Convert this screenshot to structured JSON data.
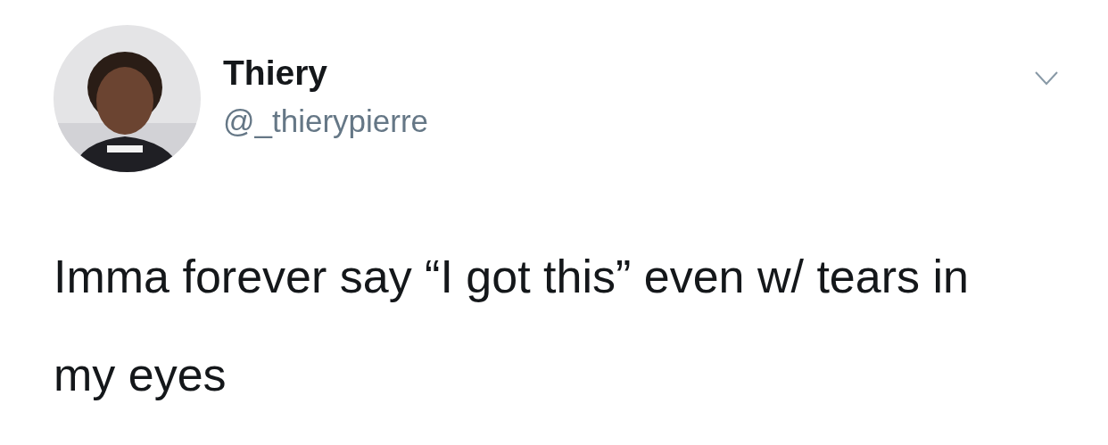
{
  "tweet": {
    "author": {
      "name": "Thiery",
      "handle": "@_thierypierre"
    },
    "text": "Imma forever say “I got this” even w/ tears in my eyes"
  }
}
